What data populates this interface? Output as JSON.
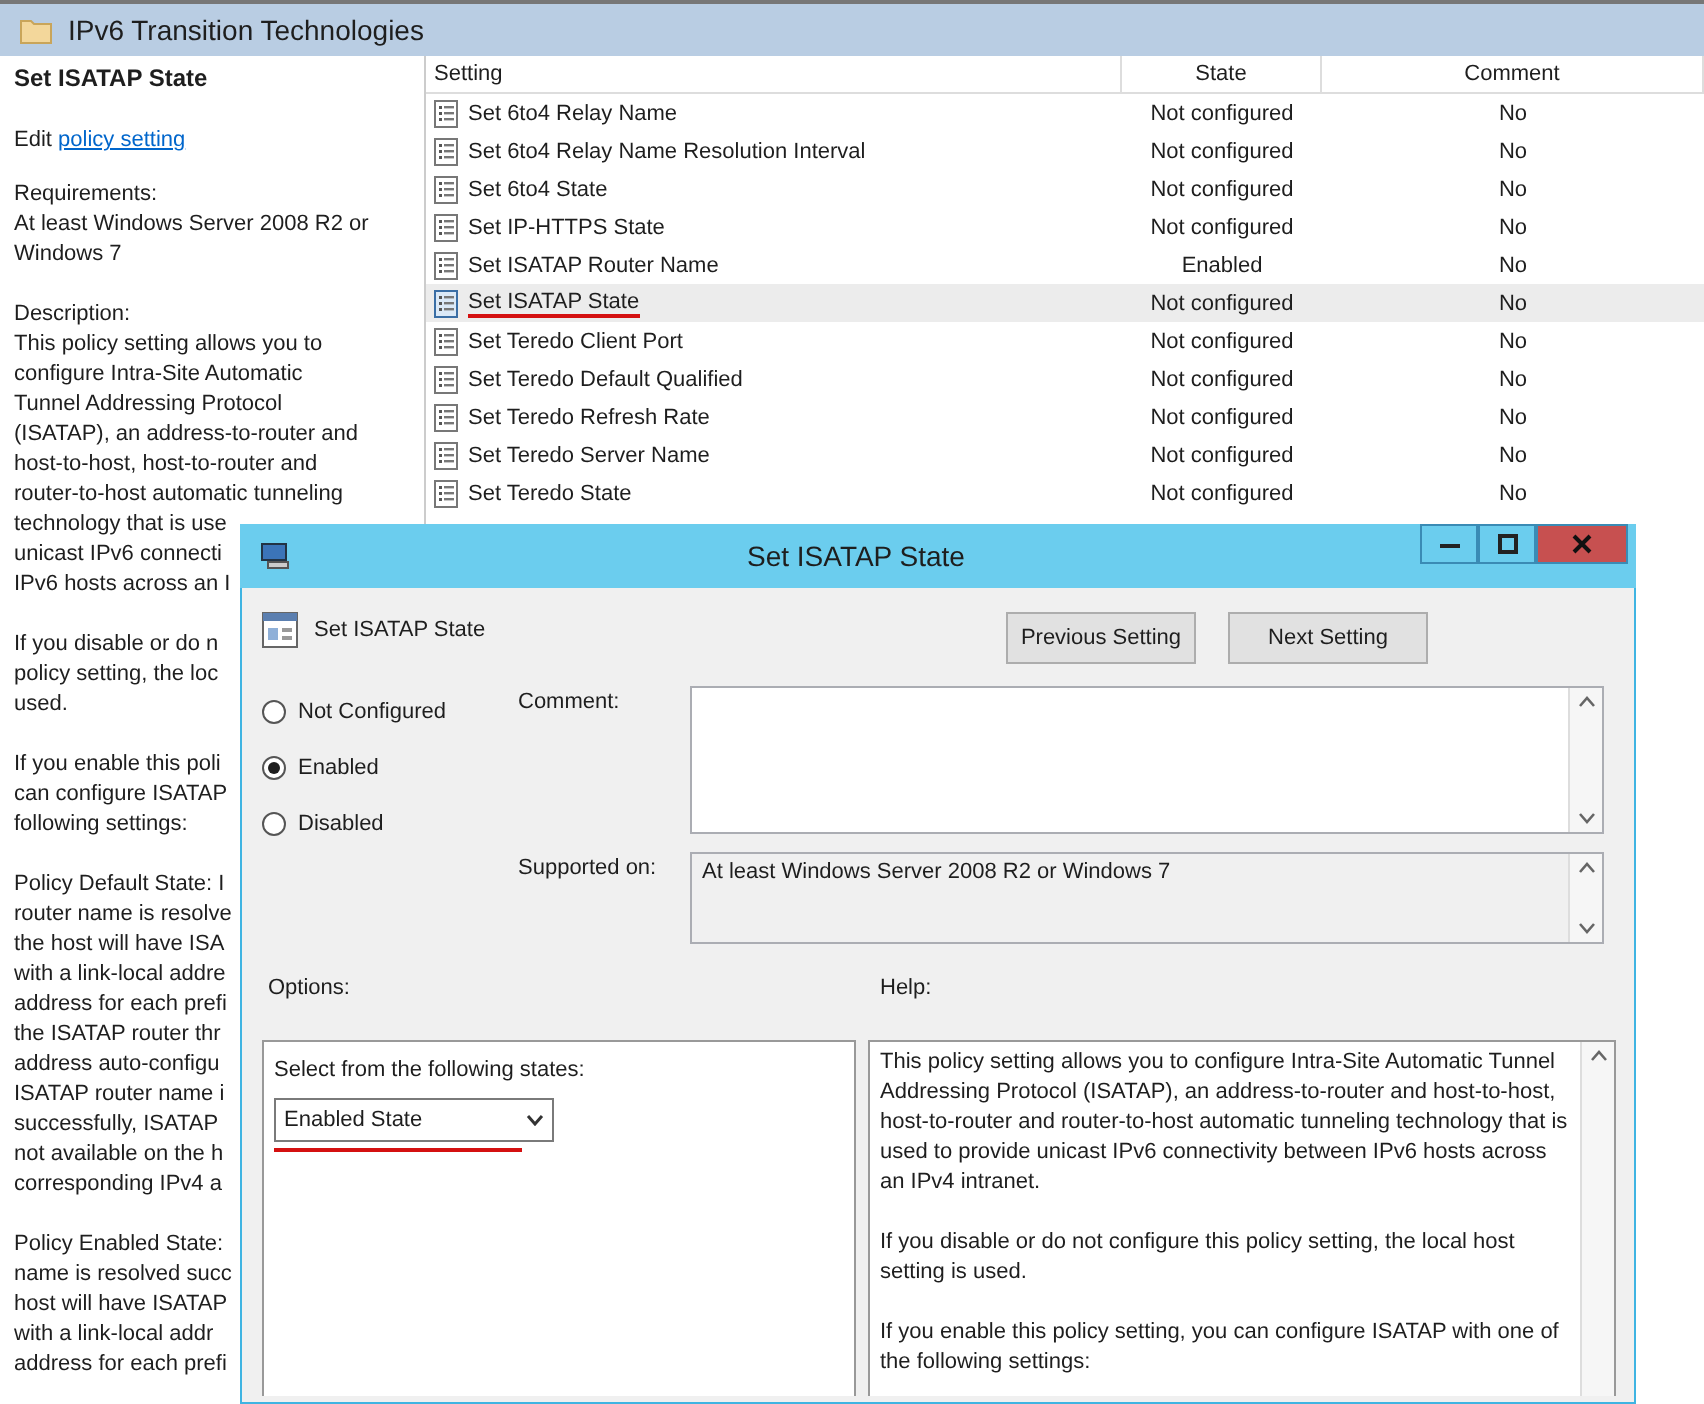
{
  "window": {
    "title": "IPv6 Transition Technologies"
  },
  "details": {
    "title": "Set ISATAP State",
    "edit_prefix": "Edit",
    "edit_link": "policy setting",
    "paragraphs": [
      [
        "Requirements:",
        "At least Windows Server 2008 R2 or",
        "Windows 7"
      ],
      [
        "Description:",
        "This policy setting allows you to",
        "configure Intra-Site Automatic",
        "Tunnel Addressing Protocol",
        "(ISATAP), an address-to-router and",
        "host-to-host, host-to-router and",
        "router-to-host automatic tunneling",
        "technology that is use",
        "unicast IPv6 connecti",
        "IPv6 hosts across an I"
      ],
      [
        "If you disable or do n",
        "policy setting, the loc",
        "used."
      ],
      [
        "If you enable this poli",
        "can configure ISATAP",
        "following settings:"
      ],
      [
        "Policy Default State: I",
        "router name is resolve",
        "the host will have ISA",
        "with a link-local addre",
        "address for each prefi",
        "the ISATAP router thr",
        "address auto-configu",
        "ISATAP router name i",
        "successfully, ISATAP",
        "not available on the h",
        "corresponding IPv4 a"
      ],
      [
        "Policy Enabled State:",
        "name is resolved succ",
        "host will have ISATAP",
        "with a link-local addr",
        "address for each prefi"
      ]
    ]
  },
  "table": {
    "columns": [
      "Setting",
      "State",
      "Comment"
    ],
    "rows": [
      {
        "setting": "Set 6to4 Relay Name",
        "state": "Not configured",
        "comment": "No",
        "selected": false,
        "underlined": false
      },
      {
        "setting": "Set 6to4 Relay Name Resolution Interval",
        "state": "Not configured",
        "comment": "No",
        "selected": false,
        "underlined": false
      },
      {
        "setting": "Set 6to4 State",
        "state": "Not configured",
        "comment": "No",
        "selected": false,
        "underlined": false
      },
      {
        "setting": "Set IP-HTTPS State",
        "state": "Not configured",
        "comment": "No",
        "selected": false,
        "underlined": false
      },
      {
        "setting": "Set ISATAP Router Name",
        "state": "Enabled",
        "comment": "No",
        "selected": false,
        "underlined": false
      },
      {
        "setting": "Set ISATAP State",
        "state": "Not configured",
        "comment": "No",
        "selected": true,
        "underlined": true
      },
      {
        "setting": "Set Teredo Client Port",
        "state": "Not configured",
        "comment": "No",
        "selected": false,
        "underlined": false
      },
      {
        "setting": "Set Teredo Default Qualified",
        "state": "Not configured",
        "comment": "No",
        "selected": false,
        "underlined": false
      },
      {
        "setting": "Set Teredo Refresh Rate",
        "state": "Not configured",
        "comment": "No",
        "selected": false,
        "underlined": false
      },
      {
        "setting": "Set Teredo Server Name",
        "state": "Not configured",
        "comment": "No",
        "selected": false,
        "underlined": false
      },
      {
        "setting": "Set Teredo State",
        "state": "Not configured",
        "comment": "No",
        "selected": false,
        "underlined": false
      }
    ]
  },
  "dialog": {
    "title": "Set ISATAP State",
    "heading": "Set ISATAP State",
    "buttons": [
      "Previous Setting",
      "Next Setting"
    ],
    "radios": [
      {
        "label": "Not Configured",
        "selected": false
      },
      {
        "label": "Enabled",
        "selected": true
      },
      {
        "label": "Disabled",
        "selected": false
      }
    ],
    "comment_label": "Comment:",
    "supported_label": "Supported on:",
    "supported_value": "At least Windows Server 2008 R2 or Windows 7",
    "options_label": "Options:",
    "help_label": "Help:",
    "options": {
      "prompt": "Select from the following states:",
      "value": "Enabled State",
      "underlined": true
    },
    "help": [
      "This policy setting allows you to configure Intra-Site Automatic Tunnel Addressing Protocol (ISATAP), an address-to-router and host-to-host, host-to-router and router-to-host automatic tunneling technology that is used to provide unicast IPv6 connectivity between IPv6 hosts across an IPv4 intranet.",
      "If you disable or do not configure this policy setting, the local host setting is used.",
      "If you enable this policy setting, you can configure ISATAP with one of the following settings:"
    ]
  }
}
